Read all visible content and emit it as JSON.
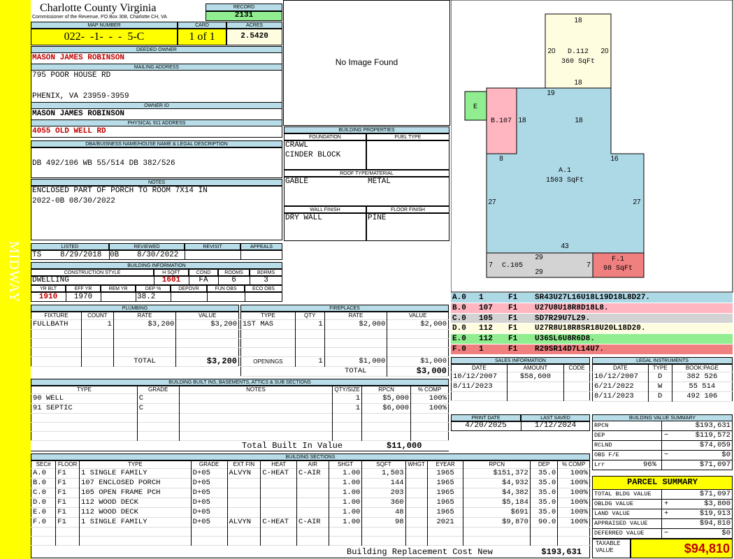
{
  "side_label": "MIDWAY",
  "header": {
    "county": "Charlotte County Virginia",
    "commissioner": "Commissioner of the Revenue, PO Box 308, Charlotte CH, VA",
    "record_label": "RECORD",
    "record": "2131"
  },
  "parcel": {
    "map_label": "MAP NUMBER",
    "map_number": "022-  -1-  -  -  5-C",
    "card_label": "CARD",
    "card": "1 of 1",
    "acres_label": "ACRES",
    "acres": "2.5420"
  },
  "owner": {
    "deeded_label": "DEEDED OWNER",
    "deeded_owner": "MASON JAMES ROBINSON",
    "mailing_label": "MAILING ADDRESS",
    "address1": "795 POOR HOUSE RD",
    "address2": "PHENIX, VA 23959-3959",
    "owner_id_label": "OWNER ID",
    "owner_id": "MASON JAMES ROBINSON",
    "physical_label": "PHYSICAL 911 ADDRESS",
    "physical": "4055 OLD WELL RD"
  },
  "legal": {
    "label": "DBA/BUISNESS NAME/HOUSE NAME & LEGAL DESCRIPTION",
    "text": "DB 492/106 WB 55/514 DB 382/526"
  },
  "notes": {
    "label": "NOTES",
    "line1": "ENCLOSED PART OF PORCH TO ROOM 7X14 IN",
    "line2": "2022-0B 08/30/2022"
  },
  "image": {
    "text": "No Image Found"
  },
  "listing": {
    "listed_label": "LISTED",
    "reviewed_label": "REVIEWED",
    "revisit_label": "REVISIT",
    "appeals_label": "APPEALS",
    "lister": "TS",
    "listed": "8/29/2018",
    "reviewer": "0B",
    "reviewed": "8/30/2022"
  },
  "building_info": {
    "label": "BUILDING INFORMATION",
    "style_label": "CONSTRUCTION STYLE",
    "hsqft_label": "H SQFT",
    "cond_label": "COND",
    "rooms_label": "ROOMS",
    "bdrms_label": "BDRMS",
    "style": "DWELLING",
    "hsqft": "1601",
    "cond": "FA",
    "rooms": "6",
    "bdrms": "3",
    "yrblt_label": "YR BLT",
    "effyr_label": "EFF YR",
    "remyr_label": "REM YR",
    "dep_label": "DEP %",
    "depovr_label": "DEPOVR",
    "funobs_label": "FUN OBS",
    "ecoobs_label": "ECO OBS",
    "yrblt": "1910",
    "effyr": "1970",
    "remyr": "",
    "dep": "38.2"
  },
  "building_props": {
    "label": "BUILDING PROPERTIES",
    "foundation_label": "FOUNDATION",
    "fuel_label": "FUEL TYPE",
    "foundation1": "CRAWL",
    "foundation2": "CINDER BLOCK",
    "roof_label": "ROOF TYPE/MATERIAL",
    "roof_type": "GABLE",
    "roof_material": "METAL",
    "wall_label": "WALL FINISH",
    "floor_label": "FLOOR FINISH",
    "wall": "DRY WALL",
    "floor": "PINE"
  },
  "plumbing": {
    "label": "PLUMBING",
    "headers": [
      "FIXTURE",
      "COUNT",
      "RATE",
      "VALUE"
    ],
    "rows": [
      [
        "FULLBATH",
        "1",
        "$3,200",
        "$3,200"
      ]
    ],
    "total_label": "TOTAL",
    "total": "$3,200"
  },
  "fireplaces": {
    "label": "FIREPLACES",
    "headers": [
      "TYPE",
      "QTY",
      "RATE",
      "VALUE"
    ],
    "rows": [
      [
        "1ST MAS",
        "1",
        "$2,000",
        "$2,000"
      ]
    ],
    "openings_label": "OPENINGS",
    "openings": [
      "1",
      "$1,000",
      "$1,000"
    ],
    "total_label": "TOTAL",
    "total": "$3,000"
  },
  "builtins": {
    "label": "BUILDING BUILT INS, BASEMENTS, ATTICS & SUB SECTIONS",
    "headers": [
      "TYPE",
      "GRADE",
      "NOTES",
      "QTY/SIZE",
      "RPCN",
      "% COMP"
    ],
    "rows": [
      [
        "90 WELL",
        "C",
        "",
        "1",
        "$5,000",
        "100%"
      ],
      [
        "91 SEPTIC",
        "C",
        "",
        "1",
        "$6,000",
        "100%"
      ]
    ],
    "total_label": "Total Built In Value",
    "total": "$11,000"
  },
  "sections": {
    "label": "BUILDING SECTIONS",
    "headers": [
      "SEC#",
      "FLOOR",
      "TYPE",
      "GRADE",
      "EXT FIN",
      "HEAT",
      "AIR",
      "SHGT",
      "SQFT",
      "WHGT",
      "EYEAR",
      "RPCN",
      "DEP",
      "% COMP"
    ],
    "rows": [
      [
        "A.0",
        "F1",
        "1 SINGLE FAMILY",
        "D+05",
        "ALVYN",
        "C-HEAT",
        "C-AIR",
        "1.00",
        "1,503",
        "",
        "1965",
        "$151,372",
        "35.0",
        "100%"
      ],
      [
        "B.0",
        "F1",
        "107 ENCLOSED PORCH",
        "D+05",
        "",
        "",
        "",
        "1.00",
        "144",
        "",
        "1965",
        "$4,932",
        "35.0",
        "100%"
      ],
      [
        "C.0",
        "F1",
        "105 OPEN FRAME PCH",
        "D+05",
        "",
        "",
        "",
        "1.00",
        "203",
        "",
        "1965",
        "$4,382",
        "35.0",
        "100%"
      ],
      [
        "D.0",
        "F1",
        "112 WOOD DECK",
        "D+05",
        "",
        "",
        "",
        "1.00",
        "360",
        "",
        "1965",
        "$5,184",
        "35.0",
        "100%"
      ],
      [
        "E.0",
        "F1",
        "112 WOOD DECK",
        "D+05",
        "",
        "",
        "",
        "1.00",
        "48",
        "",
        "1965",
        "$691",
        "35.0",
        "100%"
      ],
      [
        "F.0",
        "F1",
        "1 SINGLE FAMILY",
        "D+05",
        "ALVYN",
        "C-HEAT",
        "C-AIR",
        "1.00",
        "98",
        "",
        "2021",
        "$9,870",
        "90.0",
        "100%"
      ]
    ],
    "total_label": "Building Replacement Cost New",
    "total": "$193,631"
  },
  "sketch": {
    "d_label": "D.112",
    "d_area": "360 SqFt",
    "a_label": "A.1",
    "a_area": "1503 SqFt",
    "b_label": "B.107",
    "c_label": "C.105",
    "e_label": "E",
    "f_label": "F.1",
    "f_area": "98 SqFt",
    "dims": {
      "d_top": "18",
      "d_left": "20",
      "d_right": "20",
      "d_bottom": "18",
      "a_top": "19",
      "b_right": "18",
      "a_right_top": "18",
      "b_bottom": "8",
      "a_step": "16",
      "a_left": "27",
      "a_right": "27",
      "a_bottom": "43",
      "c_top": "29",
      "c_left": "7",
      "c_right": "7",
      "c_bottom": "29"
    },
    "colors": {
      "a": "#add8e6",
      "b": "#ffb6c1",
      "c": "#d3d3d3",
      "d": "#fffde0",
      "e": "#90ee90",
      "f": "#f08080"
    }
  },
  "vectors": [
    {
      "sec": "A.0",
      "num": "1",
      "fl": "F1",
      "vec": "SR43U27L16U18L19D18L8D27.",
      "color": "#add8e6"
    },
    {
      "sec": "B.0",
      "num": "107",
      "fl": "F1",
      "vec": "U27U8U18R8D18L8.",
      "color": "#ffb6c1"
    },
    {
      "sec": "C.0",
      "num": "105",
      "fl": "F1",
      "vec": "SD7R29U7L29.",
      "color": "#d3d3d3"
    },
    {
      "sec": "D.0",
      "num": "112",
      "fl": "F1",
      "vec": "U27R8U18R8SR18U20L18D20.",
      "color": "#fffde0"
    },
    {
      "sec": "E.0",
      "num": "112",
      "fl": "F1",
      "vec": "U36SL6U8R6D8.",
      "color": "#90ee90"
    },
    {
      "sec": "F.0",
      "num": "1",
      "fl": "F1",
      "vec": "R29SR14D7L14U7.",
      "color": "#f08080"
    }
  ],
  "sales": {
    "label": "SALES INFORMATION",
    "headers": [
      "DATE",
      "AMOUNT",
      "CODE"
    ],
    "rows": [
      [
        "10/12/2007",
        "$58,600",
        ""
      ],
      [
        "8/11/2023",
        "",
        ""
      ]
    ]
  },
  "instruments": {
    "label": "LEGAL INSTRUMENTS",
    "headers": [
      "DATE",
      "TYPE",
      "BOOK:PAGE"
    ],
    "rows": [
      [
        "10/12/2007",
        "D",
        "382 526"
      ],
      [
        "6/21/2022",
        "W",
        "55 514"
      ],
      [
        "8/11/2023",
        "D",
        "492 106"
      ]
    ]
  },
  "print": {
    "print_label": "PRINT DATE",
    "saved_label": "LAST SAVED",
    "print_date": "4/20/2025",
    "last_saved": "1/12/2024"
  },
  "value_summary": {
    "label": "BUILDING VALUE SUMMARY",
    "rows": [
      {
        "k": "RPCN",
        "s": "",
        "v": "$193,631"
      },
      {
        "k": "DEP",
        "s": "−",
        "v": "$119,572"
      },
      {
        "k": "RCLND",
        "s": "",
        "v": "$74,059"
      },
      {
        "k": "OBS F/E",
        "s": "−",
        "v": "$0"
      },
      {
        "k": "Lrr",
        "p": "96%",
        "s": "",
        "v": "$71,097"
      }
    ]
  },
  "parcel_summary": {
    "label": "PARCEL SUMMARY",
    "rows": [
      {
        "k": "TOTAL BLDG VALUE",
        "s": "",
        "v": "$71,097"
      },
      {
        "k": "OBLDG VALUE",
        "s": "+",
        "v": "$3,800"
      },
      {
        "k": "LAND VALUE",
        "s": "+",
        "v": "$19,913"
      },
      {
        "k": "APPRAISED VALUE",
        "s": "",
        "v": "$94,810"
      },
      {
        "k": "DEFERRED VALUE",
        "s": "−",
        "v": "$0"
      }
    ],
    "taxable_label": "TAXABLE VALUE",
    "taxable": "$94,810"
  }
}
